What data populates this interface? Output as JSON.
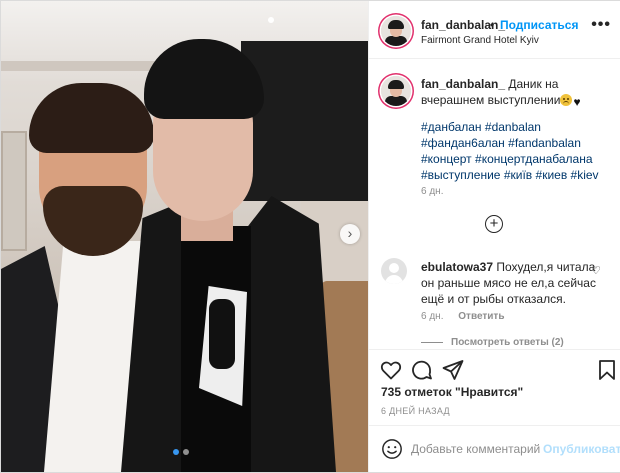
{
  "header": {
    "username": "fan_danbalan_",
    "separator": "•",
    "follow_label": "Подписаться",
    "location": "Fairmont Grand Hotel Kyiv",
    "more_icon": "•••"
  },
  "caption": {
    "username": "fan_danbalan_",
    "text": "Даник на вчерашнем выступлении",
    "emojis": [
      "smiling-face-icon",
      "black-heart-icon"
    ],
    "hashtags": [
      "#данбалан",
      "#danbalan",
      "#фандан6алан",
      "#fandanbalan",
      "#концерт",
      "#концертданабалана",
      "#выступление",
      "#київ",
      "#киев",
      "#kiev"
    ],
    "time": "6 дн."
  },
  "load_more_icon": "+",
  "comments": [
    {
      "username": "ebulatowa37",
      "text": "Похудел,я читала он раньше мясо не ел,а сейчас ещё и от рыбы отказался.",
      "time": "6 дн.",
      "reply_label": "Ответить",
      "like_icon": "♡",
      "view_replies": "Посмотреть ответы (2)"
    }
  ],
  "actions": {
    "icons": [
      "heart-icon",
      "comment-icon",
      "share-icon",
      "bookmark-icon"
    ]
  },
  "likes": "735 отметок \"Нравится\"",
  "date": "6 ДНЕЙ НАЗАД",
  "add_comment": {
    "placeholder": "Добавьте комментарий...",
    "publish_label": "Опубликовать"
  },
  "carousel": {
    "current": 1,
    "total": 2
  },
  "colors": {
    "link": "#0095f6",
    "hashtag": "#00376b",
    "muted": "#8e8e8e",
    "publish_disabled": "#b2dffc",
    "story_ring": "#e1306c"
  }
}
